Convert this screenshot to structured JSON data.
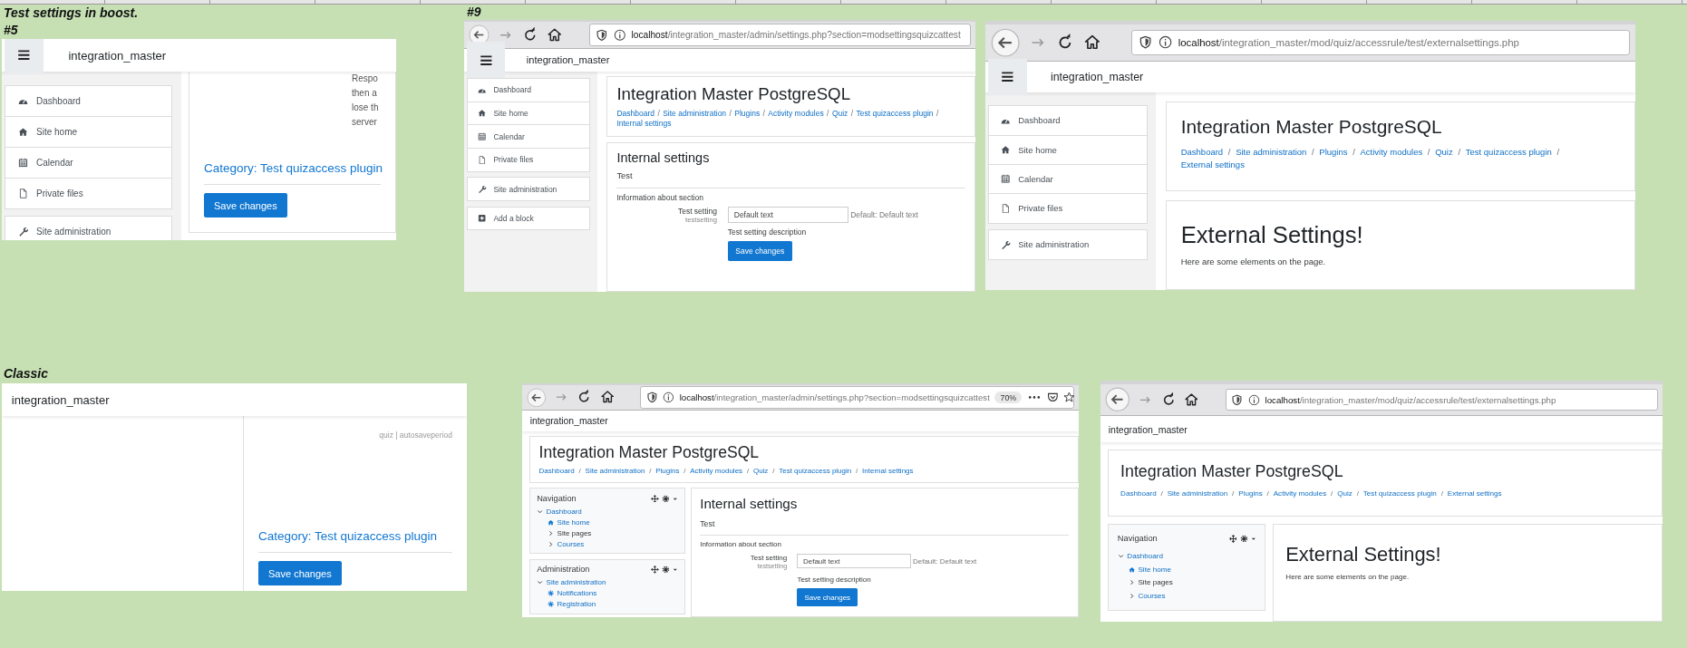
{
  "sheet_labels": [
    {
      "text": "Test settings in boost."
    },
    {
      "text": "#9"
    },
    {
      "text": "#5"
    },
    {
      "text": "Classic"
    }
  ],
  "screenshots": [
    {
      "kind": "boost",
      "site_name": "integration_master",
      "sidebar_groups": [
        {
          "items": [
            {
              "label": "Dashboard",
              "kind": "dashboard"
            },
            {
              "label": "Site home",
              "kind": "home"
            },
            {
              "label": "Calendar",
              "kind": "calendar"
            },
            {
              "label": "Private files",
              "kind": "file"
            }
          ]
        },
        {
          "items": [
            {
              "label": "Site administration",
              "kind": "wrench"
            }
          ]
        }
      ],
      "main": [
        {
          "kind": "fragment",
          "lines": [
            "Respo",
            "then a",
            "lose th",
            "server"
          ]
        },
        {
          "kind": "category",
          "text": "Category: Test quizaccess plugin"
        },
        {
          "kind": "button",
          "text": "Save changes"
        }
      ]
    },
    {
      "kind": "boost",
      "browser": {
        "host": "localhost",
        "path": "/integration_master/admin/settings.php?section=modsettingsquizcattest"
      },
      "site_name": "integration_master",
      "sidebar_groups": [
        {
          "items": [
            {
              "label": "Dashboard",
              "kind": "dashboard"
            },
            {
              "label": "Site home",
              "kind": "home"
            },
            {
              "label": "Calendar",
              "kind": "calendar"
            },
            {
              "label": "Private files",
              "kind": "file"
            }
          ]
        },
        {
          "items": [
            {
              "label": "Site administration",
              "kind": "wrench"
            }
          ]
        },
        {
          "items": [
            {
              "label": "Add a block",
              "kind": "plus"
            }
          ]
        }
      ],
      "header": {
        "title": "Integration Master PostgreSQL",
        "breadcrumbs": {
          "separator": "/",
          "items": [
            "Dashboard",
            "Site administration",
            "Plugins",
            "Activity modules",
            "Quiz",
            "Test quizaccess plugin",
            "Internal settings"
          ]
        }
      },
      "main": [
        {
          "kind": "heading",
          "text": "Internal settings"
        },
        {
          "kind": "section",
          "text": "Test"
        },
        {
          "kind": "text",
          "text": "Information about section"
        },
        {
          "kind": "setting",
          "label": "Test setting",
          "name": "testsetting",
          "value": "Default text",
          "default": "Default: Default text",
          "description": "Test setting description"
        },
        {
          "kind": "form_button",
          "text": "Save changes"
        }
      ]
    },
    {
      "kind": "boost",
      "browser": {
        "host": "localhost",
        "path": "/integration_master/mod/quiz/accessrule/test/externalsettings.php"
      },
      "site_name": "integration_master",
      "sidebar_groups": [
        {
          "items": [
            {
              "label": "Dashboard",
              "kind": "dashboard"
            },
            {
              "label": "Site home",
              "kind": "home"
            },
            {
              "label": "Calendar",
              "kind": "calendar"
            },
            {
              "label": "Private files",
              "kind": "file"
            }
          ]
        },
        {
          "items": [
            {
              "label": "Site administration",
              "kind": "wrench"
            }
          ]
        }
      ],
      "header": {
        "title": "Integration Master PostgreSQL",
        "breadcrumbs": {
          "separator": "/",
          "items": [
            "Dashboard",
            "Site administration",
            "Plugins",
            "Activity modules",
            "Quiz",
            "Test quizaccess plugin",
            "External settings"
          ]
        }
      },
      "main": [
        {
          "kind": "title",
          "text": "External Settings!"
        },
        {
          "kind": "text",
          "text": "Here are some elements on the page."
        }
      ]
    },
    {
      "kind": "classic",
      "site_name": "integration_master",
      "main": [
        {
          "kind": "meta",
          "text": "quiz | autosaveperiod"
        },
        {
          "kind": "category",
          "text": "Category: Test quizaccess plugin"
        },
        {
          "kind": "button",
          "text": "Save changes"
        }
      ]
    },
    {
      "kind": "classic",
      "browser": {
        "host": "localhost",
        "path": "/integration_master/admin/settings.php?section=modsettingsquizcattest",
        "zoom": "70%",
        "page_actions": true
      },
      "site_name": "integration_master",
      "header": {
        "title": "Integration Master PostgreSQL",
        "breadcrumbs": {
          "separator": "/",
          "items": [
            "Dashboard",
            "Site administration",
            "Plugins",
            "Activity modules",
            "Quiz",
            "Test quizaccess plugin",
            "Internal settings"
          ]
        }
      },
      "blocks": [
        {
          "title": "Navigation",
          "items": [
            {
              "label": "Dashboard",
              "kind": "branch",
              "expanded": true,
              "link": true,
              "children": [
                {
                  "label": "Site home",
                  "kind": "home",
                  "link": true
                },
                {
                  "label": "Site pages",
                  "kind": "branch",
                  "expanded": false,
                  "link": false
                },
                {
                  "label": "Courses",
                  "kind": "branch",
                  "expanded": false,
                  "link": true
                }
              ]
            }
          ]
        },
        {
          "title": "Administration",
          "items": [
            {
              "label": "Site administration",
              "kind": "branch",
              "expanded": true,
              "link": true,
              "children": [
                {
                  "label": "Notifications",
                  "kind": "gear",
                  "link": true
                },
                {
                  "label": "Registration",
                  "kind": "gear",
                  "link": true
                }
              ]
            }
          ]
        }
      ],
      "main": [
        {
          "kind": "heading",
          "text": "Internal settings"
        },
        {
          "kind": "section",
          "text": "Test"
        },
        {
          "kind": "text",
          "text": "Information about section"
        },
        {
          "kind": "setting",
          "label": "Test setting",
          "name": "testsetting",
          "value": "Default text",
          "default": "Default: Default text",
          "description": "Test setting description"
        },
        {
          "kind": "form_button",
          "text": "Save changes"
        }
      ]
    },
    {
      "kind": "classic",
      "browser": {
        "host": "localhost",
        "path": "/integration_master/mod/quiz/accessrule/test/externalsettings.php"
      },
      "site_name": "integration_master",
      "header": {
        "title": "Integration Master PostgreSQL",
        "breadcrumbs": {
          "separator": "/",
          "items": [
            "Dashboard",
            "Site administration",
            "Plugins",
            "Activity modules",
            "Quiz",
            "Test quizaccess plugin",
            "External settings"
          ]
        }
      },
      "blocks": [
        {
          "title": "Navigation",
          "items": [
            {
              "label": "Dashboard",
              "kind": "branch",
              "expanded": true,
              "link": true,
              "children": [
                {
                  "label": "Site home",
                  "kind": "home",
                  "link": true
                },
                {
                  "label": "Site pages",
                  "kind": "branch",
                  "expanded": false,
                  "link": false
                },
                {
                  "label": "Courses",
                  "kind": "branch",
                  "expanded": false,
                  "link": true
                }
              ]
            }
          ]
        }
      ],
      "main": [
        {
          "kind": "title",
          "text": "External Settings!"
        },
        {
          "kind": "text",
          "text": "Here are some elements on the page."
        }
      ]
    }
  ]
}
